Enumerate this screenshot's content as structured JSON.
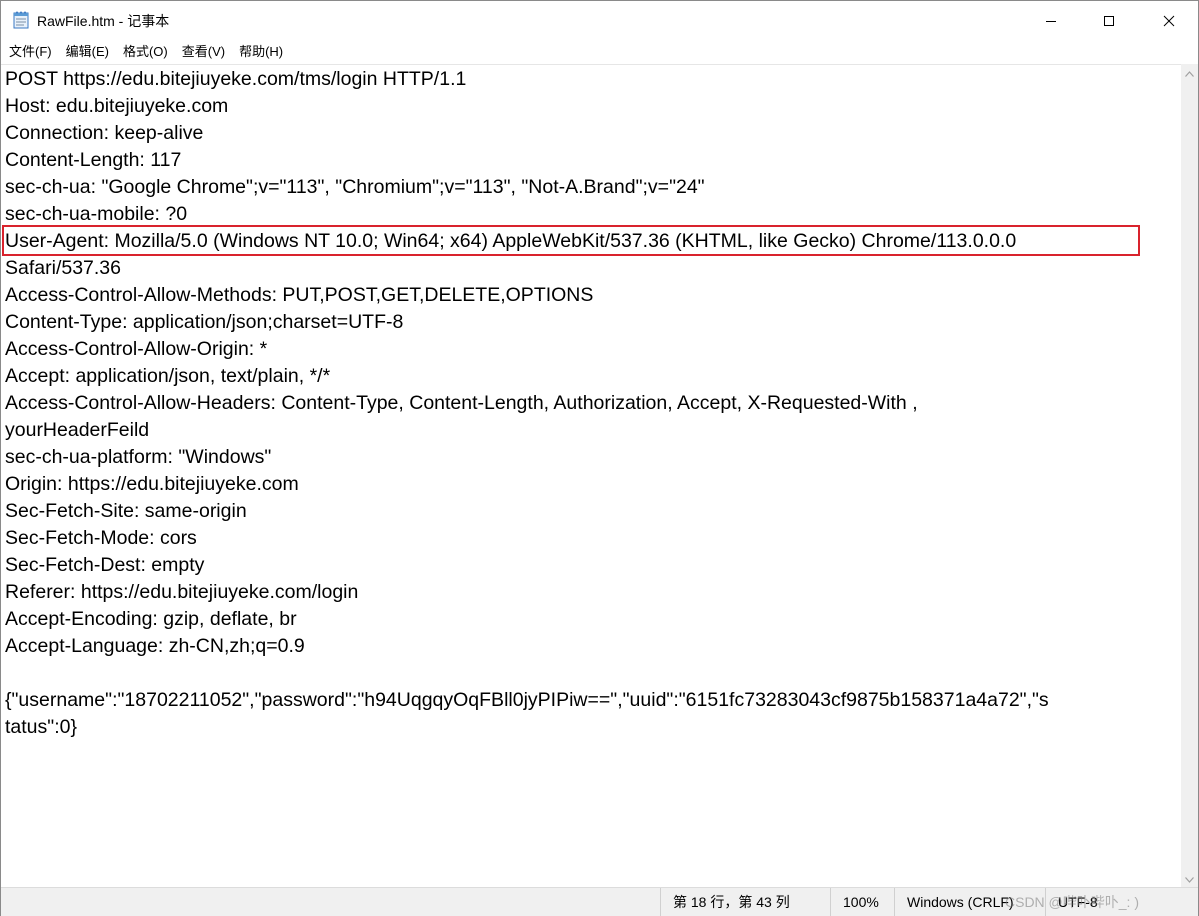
{
  "window": {
    "title": "RawFile.htm - 记事本"
  },
  "menu": [
    {
      "label": "文件(F)"
    },
    {
      "label": "编辑(E)"
    },
    {
      "label": "格式(O)"
    },
    {
      "label": "查看(V)"
    },
    {
      "label": "帮助(H)"
    }
  ],
  "editor": {
    "lines": [
      "POST https://edu.bitejiuyeke.com/tms/login HTTP/1.1",
      "Host: edu.bitejiuyeke.com",
      "Connection: keep-alive",
      "Content-Length: 117",
      "sec-ch-ua: \"Google Chrome\";v=\"113\", \"Chromium\";v=\"113\", \"Not-A.Brand\";v=\"24\"",
      "sec-ch-ua-mobile: ?0",
      "User-Agent: Mozilla/5.0 (Windows NT 10.0; Win64; x64) AppleWebKit/537.36 (KHTML, like Gecko) Chrome/113.0.0.0",
      "Safari/537.36",
      "Access-Control-Allow-Methods: PUT,POST,GET,DELETE,OPTIONS",
      "Content-Type: application/json;charset=UTF-8",
      "Access-Control-Allow-Origin: *",
      "Accept: application/json, text/plain, */*",
      "Access-Control-Allow-Headers: Content-Type, Content-Length, Authorization, Accept, X-Requested-With ,",
      "yourHeaderFeild",
      "sec-ch-ua-platform: \"Windows\"",
      "Origin: https://edu.bitejiuyeke.com",
      "Sec-Fetch-Site: same-origin",
      "Sec-Fetch-Mode: cors",
      "Sec-Fetch-Dest: empty",
      "Referer: https://edu.bitejiuyeke.com/login",
      "Accept-Encoding: gzip, deflate, br",
      "Accept-Language: zh-CN,zh;q=0.9",
      "",
      "{\"username\":\"18702211052\",\"password\":\"h94UqgqyOqFBll0jyPIPiw==\",\"uuid\":\"6151fc73283043cf9875b158371a4a72\",\"s",
      "tatus\":0}"
    ],
    "highlight_color": "#d9232d"
  },
  "statusbar": {
    "position": "第 18 行，第 43 列",
    "zoom": "100%",
    "line_ending": "Windows (CRLF)",
    "encoding": "UTF-8",
    "watermark": "CSDN @哔卟哔卟_: )"
  },
  "icons": {
    "app": "notepad-icon",
    "minimize": "minimize-icon",
    "maximize": "maximize-icon",
    "close": "close-icon"
  }
}
